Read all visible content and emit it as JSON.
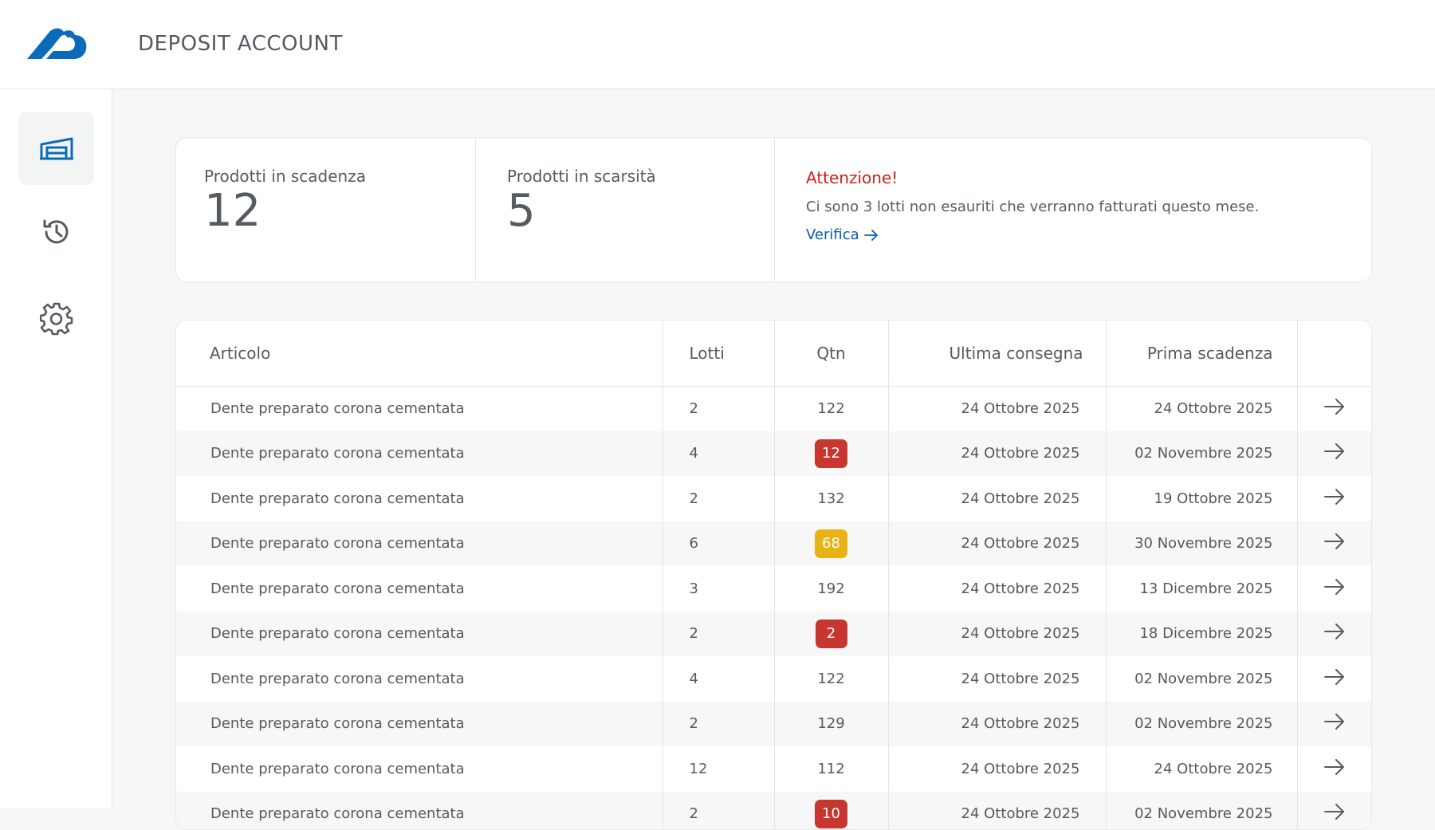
{
  "header": {
    "title": "DEPOSIT ACCOUNT",
    "logo_icon": "cloud-b-logo",
    "brand_color": "#0b6bb8"
  },
  "sidebar": {
    "items": [
      {
        "icon": "warehouse-icon",
        "active": true
      },
      {
        "icon": "history-icon",
        "active": false
      },
      {
        "icon": "gear-icon",
        "active": false
      }
    ]
  },
  "stats": {
    "expiring": {
      "label": "Prodotti in scadenza",
      "value": "12"
    },
    "scarce": {
      "label": "Prodotti in scarsità",
      "value": "5"
    },
    "alert": {
      "title": "Attenzione!",
      "text": "Ci sono 3 lotti non esauriti che verranno fatturati questo mese.",
      "link": "Verifica"
    }
  },
  "table": {
    "headers": {
      "articolo": "Articolo",
      "lotti": "Lotti",
      "qtn": "Qtn",
      "ultima": "Ultima consegna",
      "prima": "Prima scadenza"
    },
    "rows": [
      {
        "articolo": "Dente preparato corona cementata",
        "lotti": "2",
        "qtn": "122",
        "status": "none",
        "ultima": "24 Ottobre 2025",
        "prima": "24 Ottobre 2025"
      },
      {
        "articolo": "Dente preparato corona cementata",
        "lotti": "4",
        "qtn": "12",
        "status": "red",
        "ultima": "24 Ottobre 2025",
        "prima": "02 Novembre 2025"
      },
      {
        "articolo": "Dente preparato corona cementata",
        "lotti": "2",
        "qtn": "132",
        "status": "none",
        "ultima": "24 Ottobre 2025",
        "prima": "19 Ottobre 2025"
      },
      {
        "articolo": "Dente preparato corona cementata",
        "lotti": "6",
        "qtn": "68",
        "status": "yellow",
        "ultima": "24 Ottobre 2025",
        "prima": "30 Novembre 2025"
      },
      {
        "articolo": "Dente preparato corona cementata",
        "lotti": "3",
        "qtn": "192",
        "status": "none",
        "ultima": "24 Ottobre 2025",
        "prima": "13 Dicembre 2025"
      },
      {
        "articolo": "Dente preparato corona cementata",
        "lotti": "2",
        "qtn": "2",
        "status": "red",
        "ultima": "24 Ottobre 2025",
        "prima": "18 Dicembre 2025"
      },
      {
        "articolo": "Dente preparato corona cementata",
        "lotti": "4",
        "qtn": "122",
        "status": "none",
        "ultima": "24 Ottobre 2025",
        "prima": "02 Novembre 2025"
      },
      {
        "articolo": "Dente preparato corona cementata",
        "lotti": "2",
        "qtn": "129",
        "status": "none",
        "ultima": "24 Ottobre 2025",
        "prima": "02 Novembre 2025"
      },
      {
        "articolo": "Dente preparato corona cementata",
        "lotti": "12",
        "qtn": "112",
        "status": "none",
        "ultima": "24 Ottobre 2025",
        "prima": "24 Ottobre 2025"
      },
      {
        "articolo": "Dente preparato corona cementata",
        "lotti": "2",
        "qtn": "10",
        "status": "red",
        "ultima": "24 Ottobre 2025",
        "prima": "02 Novembre 2025"
      }
    ]
  },
  "colors": {
    "danger": "#c8372f",
    "warning": "#eab315",
    "link": "#0b5fa6",
    "alert_title": "#c8231f"
  }
}
